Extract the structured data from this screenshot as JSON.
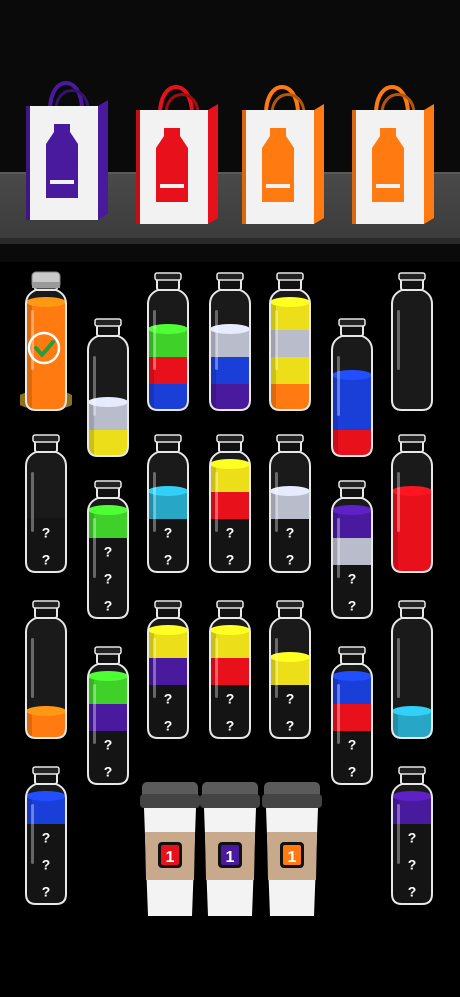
{
  "colors": {
    "purple": "#4a1a9e",
    "red": "#e8101a",
    "orange": "#ff7a10",
    "yellow": "#ecdf1a",
    "blue": "#1a3fd8",
    "green": "#3fd02a",
    "silver": "#b9bccb",
    "cyan": "#27a6c6"
  },
  "bags": [
    {
      "color": "purple"
    },
    {
      "color": "red"
    },
    {
      "color": "orange"
    },
    {
      "color": "orange"
    }
  ],
  "bottles": [
    {
      "layers": [
        "orange",
        "orange",
        "orange",
        "orange"
      ],
      "completed": true,
      "hidden": 0
    },
    {
      "layers": [
        "yellow",
        "silver"
      ],
      "completed": false,
      "hidden": 0
    },
    {
      "layers": [
        "blue",
        "red",
        "green"
      ],
      "completed": false,
      "hidden": 0
    },
    {
      "layers": [
        "purple",
        "blue",
        "silver"
      ],
      "completed": false,
      "hidden": 0
    },
    {
      "layers": [
        "orange",
        "yellow",
        "silver",
        "yellow"
      ],
      "completed": false,
      "hidden": 0
    },
    {
      "layers": [
        "red",
        "blue",
        "blue"
      ],
      "completed": false,
      "hidden": 0
    },
    {
      "layers": [],
      "completed": false,
      "hidden": 0
    },
    {
      "layers": [],
      "completed": false,
      "hidden": 2
    },
    {
      "layers": [
        "green"
      ],
      "completed": false,
      "hidden": 3
    },
    {
      "layers": [
        "cyan"
      ],
      "completed": false,
      "hidden": 2
    },
    {
      "layers": [
        "red",
        "yellow"
      ],
      "completed": false,
      "hidden": 2
    },
    {
      "layers": [
        "silver"
      ],
      "completed": false,
      "hidden": 2
    },
    {
      "layers": [
        "silver",
        "purple"
      ],
      "completed": false,
      "hidden": 2
    },
    {
      "layers": [
        "red",
        "red",
        "red"
      ],
      "completed": false,
      "hidden": 0
    },
    {
      "layers": [
        "orange"
      ],
      "completed": false,
      "hidden": 0
    },
    {
      "layers": [
        "purple",
        "green"
      ],
      "completed": false,
      "hidden": 2
    },
    {
      "layers": [
        "purple",
        "yellow"
      ],
      "completed": false,
      "hidden": 2
    },
    {
      "layers": [
        "red",
        "yellow"
      ],
      "completed": false,
      "hidden": 2
    },
    {
      "layers": [
        "yellow"
      ],
      "completed": false,
      "hidden": 2
    },
    {
      "layers": [
        "red",
        "blue"
      ],
      "completed": false,
      "hidden": 2
    },
    {
      "layers": [
        "cyan"
      ],
      "completed": false,
      "hidden": 0
    },
    {
      "layers": [
        "blue"
      ],
      "completed": false,
      "hidden": 3
    },
    {
      "layers": [
        "purple"
      ],
      "completed": false,
      "hidden": 3
    }
  ],
  "hidden_marker": "?",
  "cups": [
    {
      "label": "1",
      "color": "red"
    },
    {
      "label": "1",
      "color": "purple"
    },
    {
      "label": "1",
      "color": "orange"
    }
  ]
}
